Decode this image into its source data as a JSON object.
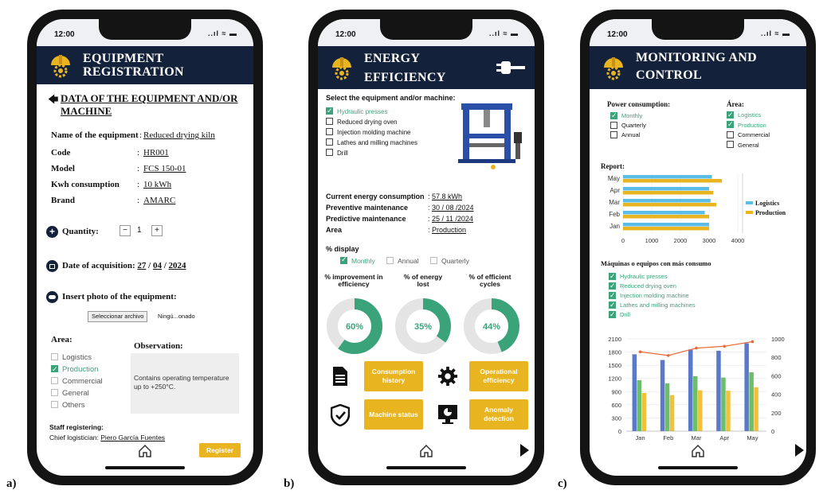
{
  "status": {
    "time": "12:00",
    "signal": "..ıl ≈ ▬"
  },
  "figure_labels": [
    "a)",
    "b)",
    "c)"
  ],
  "phone_a": {
    "title_line1": "EQUIPMENT",
    "title_line2": "REGISTRATION",
    "section_title": "DATA OF THE EQUIPMENT AND/OR MACHINE",
    "fields": [
      {
        "label": "Name of the equipment",
        "value": "Reduced drying kiln"
      },
      {
        "label": "Code",
        "value": "HR001"
      },
      {
        "label": "Model",
        "value": "FCS 150-01"
      },
      {
        "label": "Kwh consumption",
        "value": "10 kWh"
      },
      {
        "label": "Brand",
        "value": "AMARC"
      }
    ],
    "quantity_label": "Quantity:",
    "quantity_value": "1",
    "minus": "−",
    "plus": "+",
    "date_label": "Date of acquisition:",
    "date_day": "27",
    "date_month": "04",
    "date_year": "2024",
    "photo_label": "Insert photo of the equipment:",
    "file_button": "Seleccionar archivo",
    "file_status": "Ningú...onado",
    "area_label": "Area:",
    "areas": [
      {
        "label": "Logistics",
        "checked": false
      },
      {
        "label": "Production",
        "checked": true
      },
      {
        "label": "Commercial",
        "checked": false
      },
      {
        "label": "General",
        "checked": false
      },
      {
        "label": "Others",
        "checked": false
      }
    ],
    "observation_label": "Observation:",
    "observation_text": "Contains operating temperature up to +250°C.",
    "staff_label": "Staff registering:",
    "staff_role": "Chief logistician:",
    "staff_name": "Piero García Fuentes",
    "register_button": "Register"
  },
  "phone_b": {
    "title_line1": "ENERGY",
    "title_line2": "EFFICIENCY",
    "select_label": "Select the equipment and/or machine:",
    "machines": [
      {
        "label": "Hydraulic presses",
        "checked": true
      },
      {
        "label": "Reduced drying oven",
        "checked": false
      },
      {
        "label": "Injection molding machine",
        "checked": false
      },
      {
        "label": "Lathes and milling machines",
        "checked": false
      },
      {
        "label": "Drill",
        "checked": false
      }
    ],
    "info": [
      {
        "label": "Current energy consumption",
        "value": "57.8 kWh"
      },
      {
        "label": "Preventive maintenance",
        "value": "30 / 08 /2024"
      },
      {
        "label": "Predictive maintenance",
        "value": "25 / 11 /2024"
      },
      {
        "label": "Area",
        "value": "Production"
      }
    ],
    "display_label": "% display",
    "display_options": [
      {
        "label": "Monthly",
        "checked": true
      },
      {
        "label": "Annual",
        "checked": false
      },
      {
        "label": "Quarterly",
        "checked": false
      }
    ],
    "donuts": [
      {
        "label": "% improvement in efficiency",
        "value_text": "60%",
        "value": 60
      },
      {
        "label": "% of energy lost",
        "value_text": "35%",
        "value": 35
      },
      {
        "label": "% of efficient cycles",
        "value_text": "44%",
        "value": 44
      }
    ],
    "buttons": [
      "Consumption history",
      "Operational efficiency",
      "Machine status",
      "Anomaly detection"
    ],
    "accent_color": "#e8b520",
    "green_color": "#3aa37a"
  },
  "phone_c": {
    "title_line1": "MONITORING AND",
    "title_line2": "CONTROL",
    "power_label": "Power consumption:",
    "power_options": [
      {
        "label": "Monthly",
        "checked": true
      },
      {
        "label": "Quarterly",
        "checked": false
      },
      {
        "label": "Annual",
        "checked": false
      }
    ],
    "area_label": "Área:",
    "area_options": [
      {
        "label": "Logistics",
        "checked": true
      },
      {
        "label": "Production",
        "checked": true
      },
      {
        "label": "Commercial",
        "checked": false
      },
      {
        "label": "General",
        "checked": false
      }
    ],
    "report_label": "Report:",
    "machines_label": "Máquinas o equipos con más consumo",
    "machines": [
      {
        "label": "Hydraulic presses",
        "checked": true
      },
      {
        "label": "Reduced drying oven",
        "checked": true
      },
      {
        "label": "Injection molding machine",
        "checked": true
      },
      {
        "label": "Lathes and milling machines",
        "checked": true
      },
      {
        "label": "Drill",
        "checked": true
      }
    ]
  },
  "chart_data": [
    {
      "type": "bar",
      "orientation": "horizontal",
      "categories": [
        "May",
        "Apr",
        "Mar",
        "Feb",
        "Jan"
      ],
      "series": [
        {
          "name": "Logistics",
          "values": [
            3100,
            3000,
            3050,
            2850,
            3000
          ],
          "color": "#5bbde6"
        },
        {
          "name": "Production",
          "values": [
            3450,
            3150,
            3250,
            3000,
            3000
          ],
          "color": "#e8b520"
        }
      ],
      "xticks": [
        0,
        1000,
        2000,
        3000,
        4000
      ],
      "xlim": [
        0,
        4000
      ],
      "legend": "right"
    },
    {
      "type": "bar",
      "categories": [
        "Jan",
        "Feb",
        "Mar",
        "Apr",
        "May"
      ],
      "series": [
        {
          "values": [
            1750,
            1620,
            1860,
            1830,
            2000
          ],
          "color": "#5b79c8"
        },
        {
          "values": [
            1160,
            1090,
            1250,
            1220,
            1340
          ],
          "color": "#6cbf6a"
        },
        {
          "values": [
            870,
            820,
            930,
            920,
            1000
          ],
          "color": "#f2c13a"
        }
      ],
      "line": {
        "values": [
          860,
          820,
          900,
          920,
          970
        ],
        "color": "#e8693a",
        "axis": "right"
      },
      "yticks_left": [
        0,
        300,
        600,
        900,
        1200,
        1500,
        1800,
        2100
      ],
      "yticks_right": [
        0,
        200,
        400,
        600,
        800,
        1000
      ],
      "ylim_left": [
        0,
        2100
      ],
      "ylim_right": [
        0,
        1000
      ]
    }
  ]
}
